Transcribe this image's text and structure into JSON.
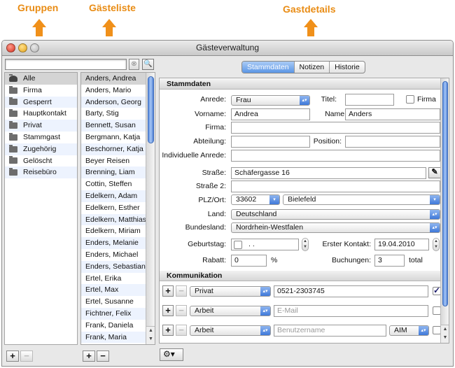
{
  "annotations": {
    "groups": "Gruppen",
    "guests": "Gästeliste",
    "details": "Gastdetails"
  },
  "window": {
    "title": "Gästeverwaltung"
  },
  "search": {
    "placeholder": "",
    "clear_icon": "clear-circle-icon",
    "search_icon": "magnifier-icon"
  },
  "groups": [
    {
      "label": "Alle",
      "icon": "people-icon"
    },
    {
      "label": "Firma",
      "icon": "folder-icon"
    },
    {
      "label": "Gesperrt",
      "icon": "folder-icon"
    },
    {
      "label": "Hauptkontakt",
      "icon": "folder-icon"
    },
    {
      "label": "Privat",
      "icon": "folder-icon"
    },
    {
      "label": "Stammgast",
      "icon": "folder-icon"
    },
    {
      "label": "Zugehörig",
      "icon": "folder-icon"
    },
    {
      "label": "Gelöscht",
      "icon": "folder-icon"
    },
    {
      "label": "Reisebüro",
      "icon": "folder-icon"
    }
  ],
  "guests": [
    "Anders, Andrea",
    "Anders, Mario",
    "Anderson, Georg",
    "Barty, Stig",
    "Bennett, Susan",
    "Bergmann, Katja",
    "Beschorner, Katja",
    "Beyer Reisen",
    "Brenning, Liam",
    "Cottin, Steffen",
    "Edelkern, Adam",
    "Edelkern, Esther",
    "Edelkern, Matthias",
    "Edelkern, Miriam",
    "Enders, Melanie",
    "Enders, Michael",
    "Enders, Sebastian",
    "Ertel, Erika",
    "Ertel, Max",
    "Ertel, Susanne",
    "Fichtner, Felix",
    "Frank, Daniela",
    "Frank, Maria"
  ],
  "tabs": [
    "Stammdaten",
    "Notizen",
    "Historie"
  ],
  "stammdaten": {
    "header": "Stammdaten",
    "anrede_label": "Anrede:",
    "anrede_value": "Frau",
    "titel_label": "Titel:",
    "titel_value": "",
    "firma_check_label": "Firma",
    "vorname_label": "Vorname:",
    "vorname_value": "Andrea",
    "name_label": "Name:",
    "name_value": "Anders",
    "firma_label": "Firma:",
    "firma_value": "",
    "abteilung_label": "Abteilung:",
    "abteilung_value": "",
    "position_label": "Position:",
    "position_value": "",
    "ind_anrede_label": "Individuelle Anrede:",
    "ind_anrede_value": "",
    "strasse_label": "Straße:",
    "strasse_value": "Schäfergasse 16",
    "strasse2_label": "Straße 2:",
    "strasse2_value": "",
    "plzort_label": "PLZ/Ort:",
    "plz_value": "33602",
    "ort_value": "Bielefeld",
    "land_label": "Land:",
    "land_value": "Deutschland",
    "bundesland_label": "Bundesland:",
    "bundesland_value": "Nordrhein-Westfalen",
    "geburtstag_label": "Geburtstag:",
    "geburtstag_value": ". .",
    "erster_kontakt_label": "Erster Kontakt:",
    "erster_kontakt_value": "19.04.2010",
    "rabatt_label": "Rabatt:",
    "rabatt_value": "0",
    "rabatt_unit": "%",
    "buchungen_label": "Buchungen:",
    "buchungen_value": "3",
    "buchungen_unit": "total"
  },
  "kommunikation": {
    "header": "Kommunikation",
    "rows": [
      {
        "type": "Privat",
        "value": "0521-2303745",
        "placeholder": "",
        "checked": true
      },
      {
        "type": "Arbeit",
        "value": "",
        "placeholder": "E-Mail",
        "checked": false
      },
      {
        "type": "Arbeit",
        "value": "",
        "placeholder": "Benutzername",
        "service": "AIM",
        "checked": false
      }
    ]
  },
  "buttons": {
    "add": "+",
    "remove": "−",
    "gear": "⚙▾"
  },
  "colors": {
    "accent": "#e98c14",
    "selection": "#d4d4d4",
    "stripe": "#edf3fe",
    "tab_active": "#5b96e6"
  }
}
